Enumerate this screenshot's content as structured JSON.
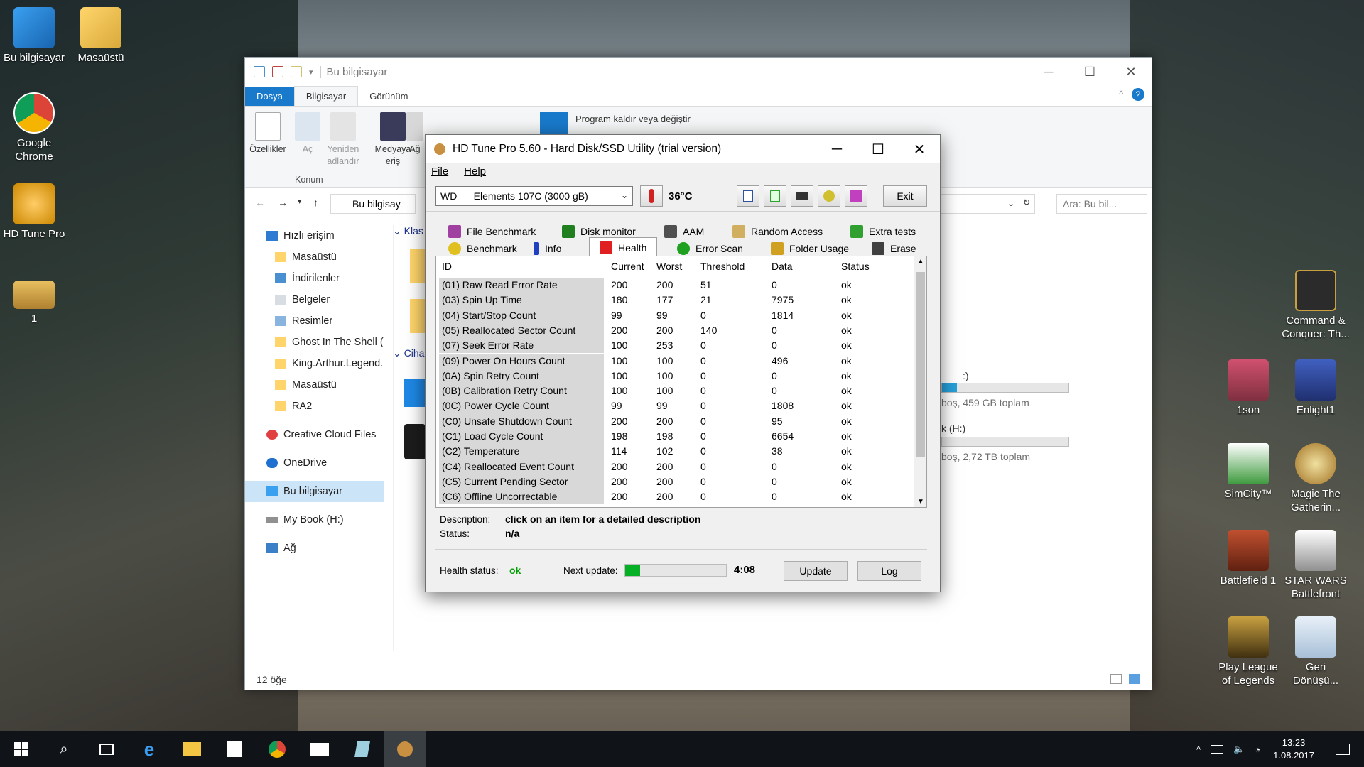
{
  "desktop": {
    "left_icons": [
      "Bu bilgisayar",
      "Masaüstü",
      "Google Chrome",
      "HD Tune Pro",
      "1"
    ],
    "right_icons": [
      "Command & Conquer: Th...",
      "1son",
      "Enlight1",
      "SimCity™",
      "Magic The Gatherin...",
      "Battlefield 1",
      "STAR WARS Battlefront",
      "Play League of Legends",
      "Geri Dönüşü..."
    ]
  },
  "explorer": {
    "title": "Bu bilgisayar",
    "tabs": [
      "Dosya",
      "Bilgisayar",
      "Görünüm"
    ],
    "ribbon": {
      "buttons": [
        "Özellikler",
        "Aç",
        "Yeniden adlandır",
        "Medyaya eriş",
        "Ağ"
      ],
      "group_label": "Konum",
      "system_item": "Program kaldır veya değiştir"
    },
    "address": "Bu bilgisay",
    "search_placeholder": "Ara: Bu bil...",
    "nav": [
      "Hızlı erişim",
      "Masaüstü",
      "İndirilenler",
      "Belgeler",
      "Resimler",
      "Ghost In The Shell (2",
      "King.Arthur.Legend.",
      "Masaüstü",
      "RA2",
      "Creative Cloud Files",
      "OneDrive",
      "Bu bilgisayar",
      "My Book (H:)",
      "Ağ"
    ],
    "sections": [
      "Klas",
      "Ciha"
    ],
    "drive_c": {
      "label": ":)",
      "free": "boş, 459 GB toplam",
      "fill": 0.12
    },
    "drive_h": {
      "label": "k (H:)",
      "free": "boş, 2,72 TB toplam",
      "fill": 0.0
    },
    "status": "12 öğe"
  },
  "hdtune": {
    "title": "HD Tune Pro 5.60 - Hard Disk/SSD Utility (trial version)",
    "menu": [
      "File",
      "Help"
    ],
    "drive": "WD      Elements 107C (3000 gB)",
    "temperature": "36°C",
    "exit_label": "Exit",
    "tabs_row1": [
      "File Benchmark",
      "Disk monitor",
      "AAM",
      "Random Access",
      "Extra tests"
    ],
    "tabs_row2": [
      "Benchmark",
      "Info",
      "Health",
      "Error Scan",
      "Folder Usage",
      "Erase"
    ],
    "active_tab": "Health",
    "columns": [
      "ID",
      "Current",
      "Worst",
      "Threshold",
      "Data",
      "Status"
    ],
    "rows": [
      [
        "(01) Raw Read Error Rate",
        "200",
        "200",
        "51",
        "0",
        "ok"
      ],
      [
        "(03) Spin Up Time",
        "180",
        "177",
        "21",
        "7975",
        "ok"
      ],
      [
        "(04) Start/Stop Count",
        "99",
        "99",
        "0",
        "1814",
        "ok"
      ],
      [
        "(05) Reallocated Sector Count",
        "200",
        "200",
        "140",
        "0",
        "ok"
      ],
      [
        "(07) Seek Error Rate",
        "100",
        "253",
        "0",
        "0",
        "ok"
      ],
      [
        "(09) Power On Hours Count",
        "100",
        "100",
        "0",
        "496",
        "ok"
      ],
      [
        "(0A) Spin Retry Count",
        "100",
        "100",
        "0",
        "0",
        "ok"
      ],
      [
        "(0B) Calibration Retry Count",
        "100",
        "100",
        "0",
        "0",
        "ok"
      ],
      [
        "(0C) Power Cycle Count",
        "99",
        "99",
        "0",
        "1808",
        "ok"
      ],
      [
        "(C0) Unsafe Shutdown Count",
        "200",
        "200",
        "0",
        "95",
        "ok"
      ],
      [
        "(C1) Load Cycle Count",
        "198",
        "198",
        "0",
        "6654",
        "ok"
      ],
      [
        "(C2) Temperature",
        "114",
        "102",
        "0",
        "38",
        "ok"
      ],
      [
        "(C4) Reallocated Event Count",
        "200",
        "200",
        "0",
        "0",
        "ok"
      ],
      [
        "(C5) Current Pending Sector",
        "200",
        "200",
        "0",
        "0",
        "ok"
      ],
      [
        "(C6) Offline Uncorrectable",
        "200",
        "200",
        "0",
        "0",
        "ok"
      ]
    ],
    "description_label": "Description:",
    "description_value": "click on an item for a detailed description",
    "status_label": "Status:",
    "status_value": "n/a",
    "health_label": "Health status:",
    "health_value": "ok",
    "next_update_label": "Next update:",
    "next_update_progress": 0.15,
    "next_update_time": "4:08",
    "update_label": "Update",
    "log_label": "Log",
    "colors": {
      "ok_green": "#00a000",
      "progress": "#06b025"
    }
  },
  "taskbar": {
    "time": "13:23",
    "date": "1.08.2017"
  }
}
